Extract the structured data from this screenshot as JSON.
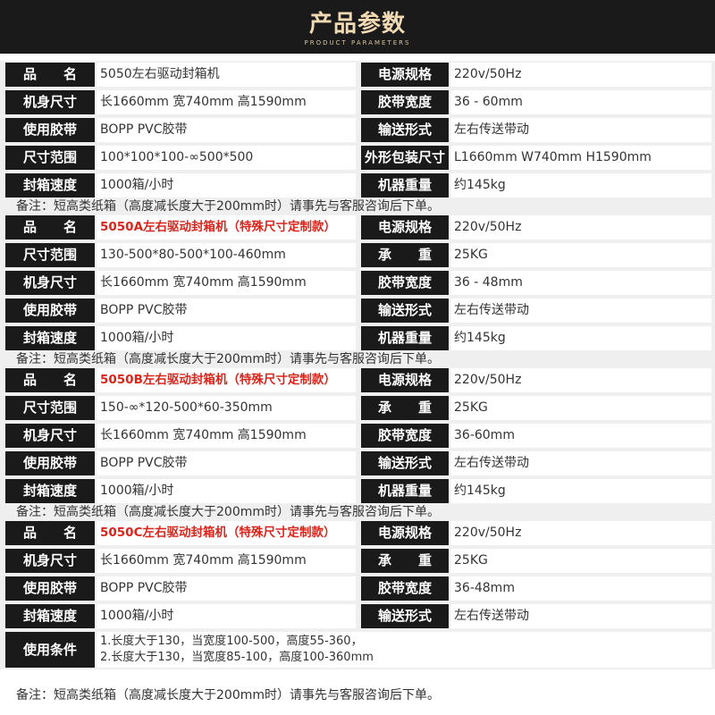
{
  "header": {
    "title": "产品参数",
    "subtitle": "PRODUCT PARAMETERS"
  },
  "sections": [
    {
      "rows": [
        {
          "l_label": "品　　名",
          "l_value": "5050左右驱动封箱机",
          "l_red": false,
          "r_label": "电源规格",
          "r_value": "220v/50Hz"
        },
        {
          "l_label": "机身尺寸",
          "l_value": "长1660mm 宽740mm 高1590mm",
          "l_red": false,
          "r_label": "胶带宽度",
          "r_value": "36  -  60mm"
        },
        {
          "l_label": "使用胶带",
          "l_value": "BOPP  PVC胶带",
          "l_red": false,
          "r_label": "输送形式",
          "r_value": "左右传送带动"
        },
        {
          "l_label": "尺寸范围",
          "l_value": "100*100*100-∞500*500",
          "l_red": false,
          "r_label": "外形包装尺寸",
          "r_value": "L1660mm  W740mm  H1590mm"
        },
        {
          "l_label": "封箱速度",
          "l_value": "1000箱/小时",
          "l_red": false,
          "r_label": "机器重量",
          "r_value": "约145kg"
        }
      ],
      "note": "备注：短高类纸箱（高度减长度大于200mm时）请事先与客服咨询后下单。"
    },
    {
      "rows": [
        {
          "l_label": "品　　名",
          "l_value": "5050A左右驱动封箱机（特殊尺寸定制款）",
          "l_red": true,
          "r_label": "电源规格",
          "r_value": "220v/50Hz"
        },
        {
          "l_label": "尺寸范围",
          "l_value": "130-500*80-500*100-460mm",
          "l_red": false,
          "r_label": "承　　重",
          "r_value": "25KG"
        },
        {
          "l_label": "机身尺寸",
          "l_value": "长1660mm 宽740mm 高1590mm",
          "l_red": false,
          "r_label": "胶带宽度",
          "r_value": "36 - 48mm"
        },
        {
          "l_label": "使用胶带",
          "l_value": "BOPP  PVC胶带",
          "l_red": false,
          "r_label": "输送形式",
          "r_value": "左右传送带动"
        },
        {
          "l_label": "封箱速度",
          "l_value": "1000箱/小时",
          "l_red": false,
          "r_label": "机器重量",
          "r_value": "约145kg"
        }
      ],
      "note": "备注：短高类纸箱（高度减长度大于200mm时）请事先与客服咨询后下单。"
    },
    {
      "rows": [
        {
          "l_label": "品　　名",
          "l_value": "5050B左右驱动封箱机（特殊尺寸定制款）",
          "l_red": true,
          "r_label": "电源规格",
          "r_value": "220v/50Hz"
        },
        {
          "l_label": "尺寸范围",
          "l_value": "150-∞*120-500*60-350mm",
          "l_red": false,
          "r_label": "承　　重",
          "r_value": "25KG"
        },
        {
          "l_label": "机身尺寸",
          "l_value": "长1660mm 宽740mm 高1590mm",
          "l_red": false,
          "r_label": "胶带宽度",
          "r_value": "36-60mm"
        },
        {
          "l_label": "使用胶带",
          "l_value": "BOPP  PVC胶带",
          "l_red": false,
          "r_label": "输送形式",
          "r_value": "左右传送带动"
        },
        {
          "l_label": "封箱速度",
          "l_value": "1000箱/小时",
          "l_red": false,
          "r_label": "机器重量",
          "r_value": "约145kg"
        }
      ],
      "note": "备注：短高类纸箱（高度减长度大于200mm时）请事先与客服咨询后下单。"
    },
    {
      "rows": [
        {
          "l_label": "品　　名",
          "l_value": "5050C左右驱动封箱机（特殊尺寸定制款）",
          "l_red": true,
          "r_label": "电源规格",
          "r_value": "220v/50Hz"
        },
        {
          "l_label": "机身尺寸",
          "l_value": "长1660mm 宽740mm 高1590mm",
          "l_red": false,
          "r_label": "承　　重",
          "r_value": "25KG"
        },
        {
          "l_label": "使用胶带",
          "l_value": "BOPP  PVC胶带",
          "l_red": false,
          "r_label": "胶带宽度",
          "r_value": "36-48mm"
        },
        {
          "l_label": "封箱速度",
          "l_value": "1000箱/小时",
          "l_red": false,
          "r_label": "输送形式",
          "r_value": "左右传送带动"
        }
      ],
      "condition": {
        "label": "使用条件",
        "line1": "1.长度大于130，当宽度100-500，高度55-360，",
        "line2": "2.长度大于130，当宽度85-100，高度100-360mm"
      }
    }
  ],
  "final_note": "备注：短高类纸箱（高度减长度大于200mm时）请事先与客服咨询后下单。"
}
